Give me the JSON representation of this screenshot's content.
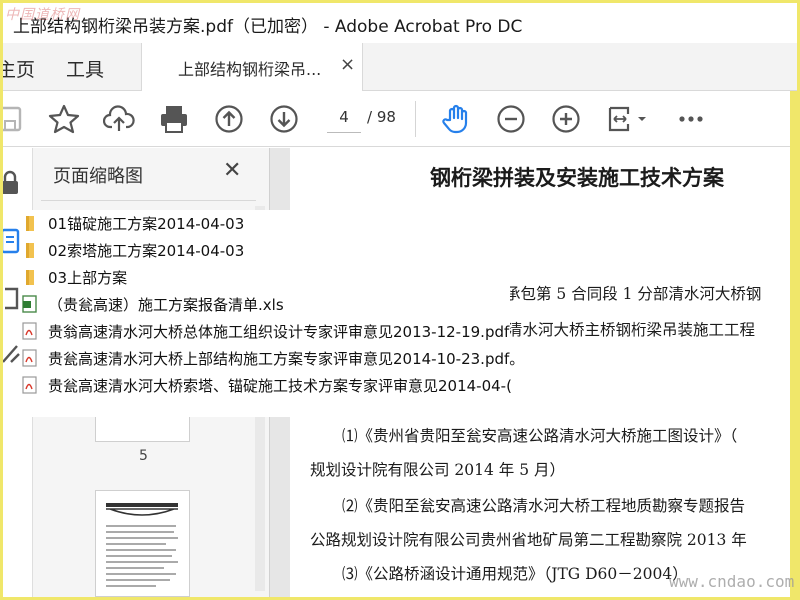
{
  "window": {
    "title": "上部结构钢桁梁吊装方案.pdf（已加密） - Adobe Acrobat Pro DC",
    "watermark_top": "中国道桥网",
    "watermark_bottom": "www.cndao.com"
  },
  "tabs": {
    "home": "主页",
    "tools": "工具",
    "document": "上部结构钢桁梁吊...",
    "close": "×"
  },
  "toolbar": {
    "current_page": "4",
    "total_pages": "/ 98",
    "icons": [
      "save-icon",
      "star-icon",
      "upload-icon",
      "print-icon",
      "page-up-icon",
      "page-down-icon",
      "hand-tool-icon",
      "zoom-out-icon",
      "zoom-in-icon",
      "fit-page-icon",
      "more-icon"
    ],
    "accent_color": "#2680eb"
  },
  "panel": {
    "title": "页面缩略图",
    "close": "✕",
    "thumb_page_number": "5"
  },
  "document": {
    "heading": "钢桁梁拼装及安装施工技术方案",
    "lines": [
      "承包第 5 合同段 1 分部清水河大桥钢",
      "清水河大桥主桥钢桁梁吊装施工工程",
      "⑴《贵州省贵阳至瓮安高速公路清水河大桥施工图设计》（",
      "规划设计院有限公司  2014 年 5 月）",
      "⑵《贵阳至瓮安高速公路清水河大桥工程地质勘察专题报告",
      "公路规划设计院有限公司贵州省地矿局第二工程勘察院  2013 年",
      "⑶《公路桥涵设计通用规范》（JTG D60－2004）"
    ]
  },
  "filelist": [
    {
      "type": "folder",
      "name": "01锚碇施工方案2014-04-03"
    },
    {
      "type": "folder",
      "name": "02索塔施工方案2014-04-03"
    },
    {
      "type": "folder",
      "name": "03上部方案"
    },
    {
      "type": "xls",
      "name": "（贵瓮高速）施工方案报备清单.xls"
    },
    {
      "type": "pdf",
      "name": "贵翁高速清水河大桥总体施工组织设计专家评审意见2013-12-19.pdf"
    },
    {
      "type": "pdf",
      "name": "贵瓮高速清水河大桥上部结构施工方案专家评审意见2014-10-23.pdf。"
    },
    {
      "type": "pdf",
      "name": "贵瓮高速清水河大桥索塔、锚碇施工技术方案专家评审意见2014-04-("
    }
  ]
}
